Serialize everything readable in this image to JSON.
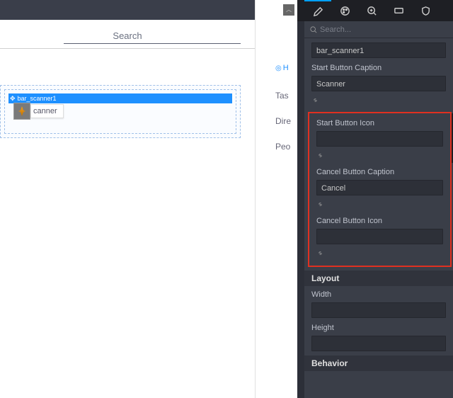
{
  "left": {
    "search_label": "Search",
    "selected_widget_id": "bar_scanner1",
    "widget_caption": "canner"
  },
  "mid": {
    "home_link": "H",
    "stubs": [
      "Tas",
      "Dire",
      "Peo"
    ]
  },
  "panel": {
    "search_placeholder": "Search...",
    "name_value": "bar_scanner1",
    "start_caption_label": "Start Button Caption",
    "start_caption_value": "Scanner",
    "start_icon_label": "Start Button Icon",
    "start_icon_value": "",
    "cancel_caption_label": "Cancel Button Caption",
    "cancel_caption_value": "Cancel",
    "cancel_icon_label": "Cancel Button Icon",
    "cancel_icon_value": "",
    "section_layout": "Layout",
    "width_label": "Width",
    "width_value": "",
    "height_label": "Height",
    "height_value": "",
    "section_behavior": "Behavior"
  }
}
